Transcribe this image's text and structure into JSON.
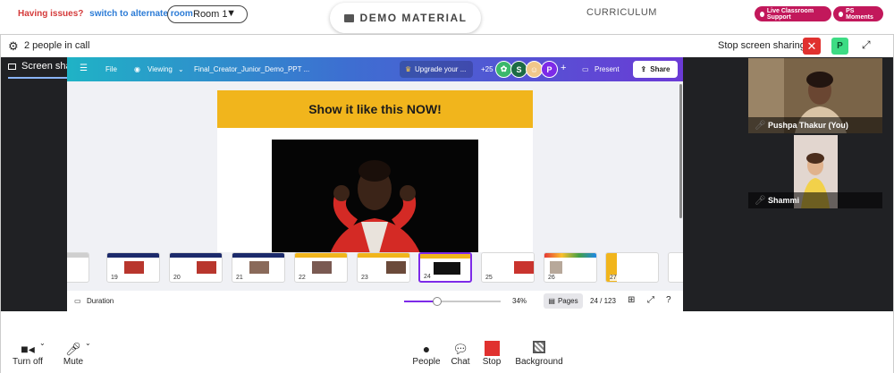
{
  "topbar": {
    "issues_text": "Having issues?",
    "alternate_link": "switch to alternate room",
    "room_value": "Room 1",
    "demo_material": "DEMO MATERIAL",
    "curriculum": "CURRICULUM",
    "live_support": "Live Classroom Support",
    "ps_moments": "PS Moments"
  },
  "call": {
    "people_count": "2 people in call",
    "stop_sharing": "Stop screen sharing",
    "self_avatar": "P",
    "screen_share_tab": "Screen share (You)"
  },
  "canva": {
    "file": "File",
    "viewing": "Viewing",
    "doc_title": "Final_Creator_Junior_Demo_PPT ...",
    "upgrade": "Upgrade your ...",
    "collab_count": "+25",
    "avatar_s": "S",
    "avatar_p": "P",
    "present": "Present",
    "share": "Share",
    "slide_title": "Show it like this NOW!",
    "thumb_numbers": [
      "19",
      "20",
      "21",
      "22",
      "23",
      "24",
      "25",
      "26",
      "27"
    ],
    "duration": "Duration",
    "zoom": "34%",
    "pages": "Pages",
    "page_counter": "24 / 123",
    "zoom_level": 0.34,
    "accent": "#7d2ae8"
  },
  "participants": {
    "self_name": "Pushpa Thakur (You)",
    "other_name": "Shammi"
  },
  "controls": {
    "turn_off": "Turn off",
    "mute": "Mute",
    "people": "People",
    "chat": "Chat",
    "stop": "Stop",
    "background": "Background"
  }
}
